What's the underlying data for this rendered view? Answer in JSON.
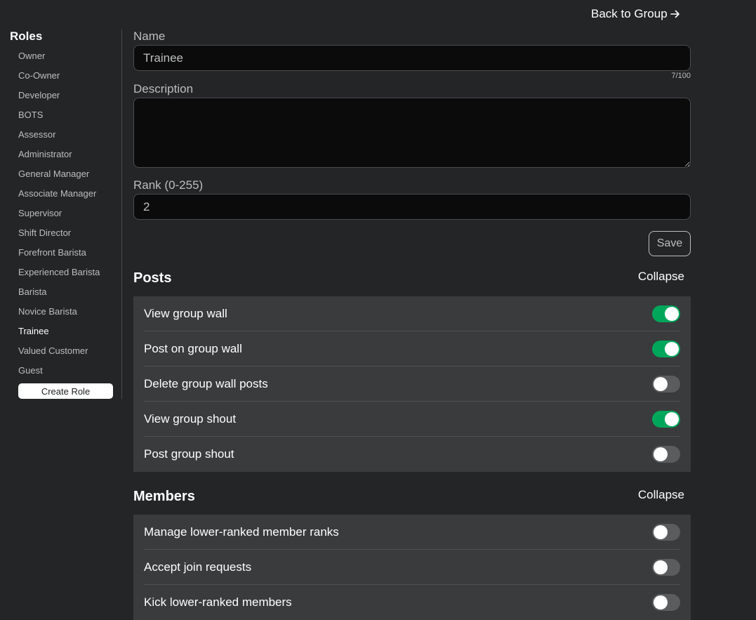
{
  "header": {
    "back_label": "Back to Group"
  },
  "sidebar": {
    "title": "Roles",
    "roles": [
      "Owner",
      "Co-Owner",
      "Developer",
      "BOTS",
      "Assessor",
      "Administrator",
      "General Manager",
      "Associate Manager",
      "Supervisor",
      "Shift Director",
      "Forefront Barista",
      "Experienced Barista",
      "Barista",
      "Novice Barista",
      "Trainee",
      "Valued Customer",
      "Guest"
    ],
    "active_role": "Trainee",
    "create_label": "Create Role"
  },
  "form": {
    "name_label": "Name",
    "name_value": "Trainee",
    "name_count": "7/100",
    "description_label": "Description",
    "description_value": "",
    "rank_label": "Rank (0-255)",
    "rank_value": "2",
    "save_label": "Save"
  },
  "sections": {
    "posts": {
      "title": "Posts",
      "collapse_label": "Collapse",
      "permissions": [
        {
          "label": "View group wall",
          "enabled": true
        },
        {
          "label": "Post on group wall",
          "enabled": true
        },
        {
          "label": "Delete group wall posts",
          "enabled": false
        },
        {
          "label": "View group shout",
          "enabled": true
        },
        {
          "label": "Post group shout",
          "enabled": false
        }
      ]
    },
    "members": {
      "title": "Members",
      "collapse_label": "Collapse",
      "permissions": [
        {
          "label": "Manage lower-ranked member ranks",
          "enabled": false
        },
        {
          "label": "Accept join requests",
          "enabled": false
        },
        {
          "label": "Kick lower-ranked members",
          "enabled": false
        }
      ]
    }
  },
  "colors": {
    "background": "#232527",
    "panel": "#393b3d",
    "toggle_on": "#00a65a",
    "toggle_off": "#5a5c5e"
  },
  "icons": {
    "back": "arrow-right-icon"
  }
}
